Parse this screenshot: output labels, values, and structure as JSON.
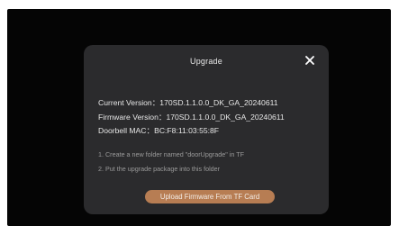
{
  "dialog": {
    "title": "Upgrade",
    "close_icon": "close-icon"
  },
  "info": {
    "current_version": "Current Version：170SD.1.1.0.0_DK_GA_20240611",
    "firmware_version": "Firmware Version：170SD.1.1.0.0_DK_GA_20240611",
    "doorbell_mac": "Doorbell MAC：BC:F8:11:03:55:8F"
  },
  "steps": [
    "1. Create a new folder named \"doorUpgrade\" in TF",
    "2. Put the upgrade package into this folder"
  ],
  "actions": {
    "upload_label": "Upload Firmware From TF Card"
  },
  "colors": {
    "screen_bg": "#050505",
    "dialog_bg": "#2b2b2d",
    "accent": "#b77d53"
  }
}
